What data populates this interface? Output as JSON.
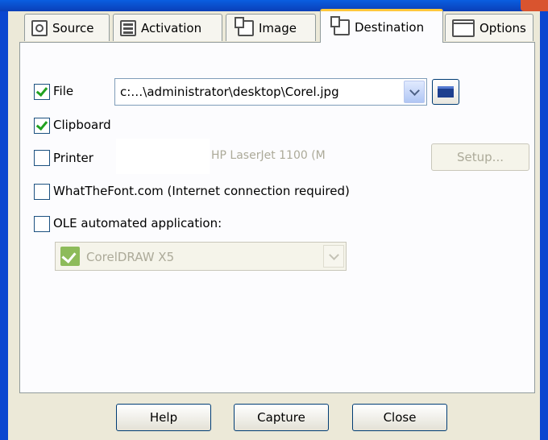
{
  "tabs": [
    {
      "label": "Source",
      "icon": "source-icon"
    },
    {
      "label": "Activation",
      "icon": "activation-icon"
    },
    {
      "label": "Image",
      "icon": "image-icon"
    },
    {
      "label": "Destination",
      "icon": "destination-icon"
    },
    {
      "label": "Options",
      "icon": "options-icon"
    }
  ],
  "active_tab": "Destination",
  "destinations": {
    "file": {
      "label": "File",
      "checked": true,
      "path": "c:…\\administrator\\desktop\\Corel.jpg"
    },
    "clipboard": {
      "label": "Clipboard",
      "checked": true
    },
    "printer": {
      "label": "Printer",
      "checked": false,
      "printer_name": "HP LaserJet 1100 (M",
      "setup_label": "Setup..."
    },
    "whatthefont": {
      "label": "WhatTheFont.com (Internet connection required)",
      "checked": false
    },
    "ole": {
      "label": "OLE automated application:",
      "checked": false,
      "application": "CorelDRAW X5"
    }
  },
  "buttons": {
    "help": "Help",
    "capture": "Capture",
    "close": "Close"
  },
  "colors": {
    "titlebar": "#0a46d0",
    "tab_highlight": "#ffc83c",
    "check": "#21a121"
  }
}
